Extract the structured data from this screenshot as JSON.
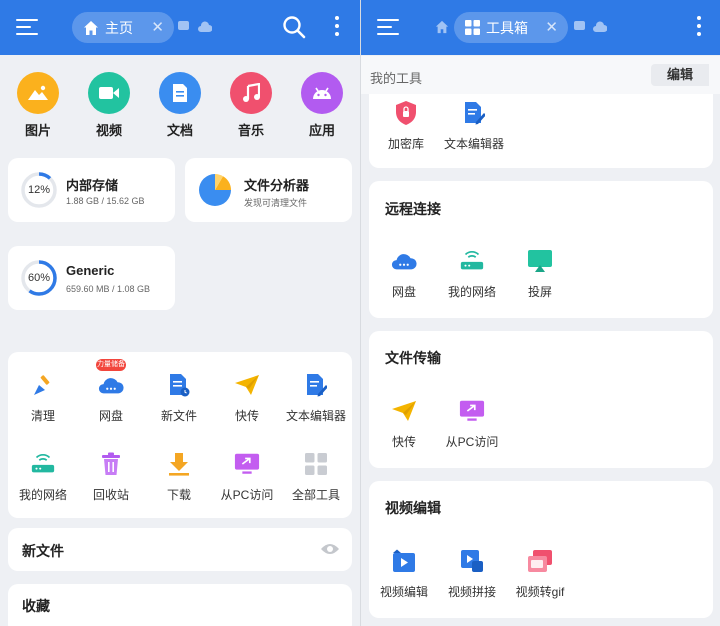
{
  "colors": {
    "topbar": "#2f7ae6",
    "card": "#ffffff",
    "background": "#eef0f4",
    "accent_blue": "#2f7ae6"
  },
  "left": {
    "topbar": {
      "tab_label": "主页",
      "icons": [
        "menu-icon",
        "home-icon",
        "close-icon",
        "tab-icon",
        "cloud-icon",
        "search-icon",
        "more-vert-icon"
      ]
    },
    "categories": [
      {
        "label": "图片",
        "icon": "image-icon",
        "color": "#fbb11d"
      },
      {
        "label": "视频",
        "icon": "video-icon",
        "color": "#22c3a0"
      },
      {
        "label": "文档",
        "icon": "document-icon",
        "color": "#3a8df0"
      },
      {
        "label": "音乐",
        "icon": "music-icon",
        "color": "#f0506e"
      },
      {
        "label": "应用",
        "icon": "android-icon",
        "color": "#b25bf0"
      }
    ],
    "storage": [
      {
        "title": "内部存储",
        "percent": "12%",
        "fraction": 0.12,
        "detail": "1.88 GB / 15.62 GB"
      },
      {
        "title": "Generic",
        "percent": "60%",
        "fraction": 0.6,
        "detail": "659.60 MB / 1.08 GB"
      }
    ],
    "analyzer": {
      "title": "文件分析器",
      "subtitle": "发现可清理文件"
    },
    "tools": [
      {
        "label": "清理",
        "icon": "broom-icon"
      },
      {
        "label": "网盘",
        "icon": "cloud-drive-icon",
        "badge": "力量储备"
      },
      {
        "label": "新文件",
        "icon": "new-file-icon"
      },
      {
        "label": "快传",
        "icon": "paper-plane-icon"
      },
      {
        "label": "文本编辑器",
        "icon": "text-editor-icon"
      },
      {
        "label": "我的网络",
        "icon": "router-icon"
      },
      {
        "label": "回收站",
        "icon": "trash-icon"
      },
      {
        "label": "下载",
        "icon": "download-icon"
      },
      {
        "label": "从PC访问",
        "icon": "pc-access-icon"
      },
      {
        "label": "全部工具",
        "icon": "grid-icon"
      }
    ],
    "rows": [
      {
        "title": "新文件",
        "icon": "eye-icon"
      },
      {
        "title": "收藏"
      }
    ]
  },
  "right": {
    "topbar": {
      "tab_label": "工具箱",
      "icons": [
        "menu-icon",
        "home-icon",
        "grid-icon",
        "close-icon",
        "tab-icon",
        "cloud-icon",
        "more-vert-icon"
      ]
    },
    "my_tools": {
      "label": "我的工具",
      "edit_button": "编辑"
    },
    "my_tools_items": [
      {
        "label": "加密库",
        "icon": "shield-lock-icon"
      },
      {
        "label": "文本编辑器",
        "icon": "text-editor-icon"
      }
    ],
    "sections": [
      {
        "title": "远程连接",
        "items": [
          {
            "label": "网盘",
            "icon": "cloud-drive-icon"
          },
          {
            "label": "我的网络",
            "icon": "router-icon"
          },
          {
            "label": "投屏",
            "icon": "cast-screen-icon"
          }
        ]
      },
      {
        "title": "文件传输",
        "items": [
          {
            "label": "快传",
            "icon": "paper-plane-icon"
          },
          {
            "label": "从PC访问",
            "icon": "pc-access-icon"
          }
        ]
      },
      {
        "title": "视频编辑",
        "items": [
          {
            "label": "视频编辑",
            "icon": "video-edit-icon"
          },
          {
            "label": "视频拼接",
            "icon": "video-merge-icon"
          },
          {
            "label": "视频转gif",
            "icon": "video-gif-icon"
          }
        ]
      }
    ]
  }
}
